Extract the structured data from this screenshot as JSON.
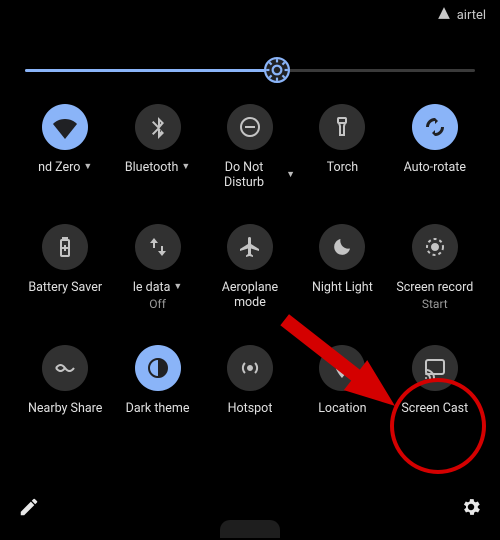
{
  "status": {
    "carrier": "airtel"
  },
  "brightness": {
    "percent": 56
  },
  "tiles": {
    "wifi": {
      "label": "nd Zero",
      "active": true,
      "has_caret": true
    },
    "bluetooth": {
      "label": "Bluetooth",
      "active": false,
      "has_caret": true
    },
    "dnd": {
      "label": "Do Not Disturb",
      "active": false,
      "has_caret": true
    },
    "torch": {
      "label": "Torch",
      "active": false
    },
    "autorotate": {
      "label": "Auto-rotate",
      "active": true
    },
    "battery": {
      "label": "Battery Saver",
      "active": false
    },
    "mobiledata": {
      "label": "le data",
      "sub": "Off",
      "active": false,
      "has_caret": true
    },
    "airplane": {
      "label": "Aeroplane mode",
      "active": false
    },
    "nightlight": {
      "label": "Night Light",
      "active": false
    },
    "screenrec": {
      "label": "Screen record",
      "sub": "Start",
      "active": false
    },
    "nearby": {
      "label": "Nearby Share",
      "active": false
    },
    "darktheme": {
      "label": "Dark theme",
      "active": true
    },
    "hotspot": {
      "label": "Hotspot",
      "active": false
    },
    "location": {
      "label": "Location",
      "active": false
    },
    "cast": {
      "label": "Screen Cast",
      "active": false
    }
  },
  "annotation": {
    "highlight_tile": "cast"
  },
  "colors": {
    "accent": "#8ab4f8",
    "annotation": "#d40000"
  }
}
